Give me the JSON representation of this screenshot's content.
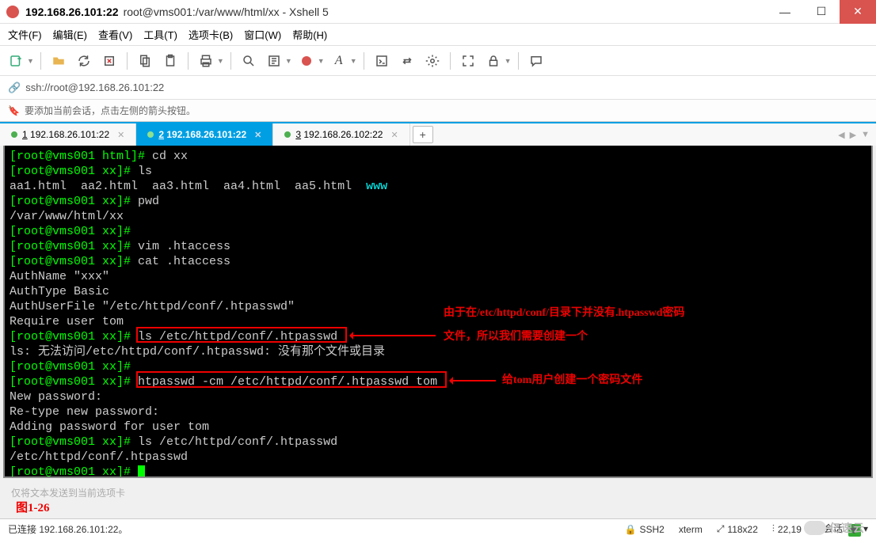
{
  "title": {
    "host": "192.168.26.101:22",
    "path": "root@vms001:/var/www/html/xx - Xshell 5"
  },
  "menu": [
    "文件(F)",
    "编辑(E)",
    "查看(V)",
    "工具(T)",
    "选项卡(B)",
    "窗口(W)",
    "帮助(H)"
  ],
  "address": "ssh://root@192.168.26.101:22",
  "infobar": "要添加当前会话，点击左侧的箭头按钮。",
  "tabs": [
    {
      "label": "1 192.168.26.101:22",
      "active": false
    },
    {
      "label": "2 192.168.26.101:22",
      "active": true
    },
    {
      "label": "3 192.168.26.102:22",
      "active": false
    }
  ],
  "terminal_lines": [
    {
      "seg": [
        {
          "c": "tp",
          "t": "[root@vms001 html]# "
        },
        {
          "c": "tc",
          "t": "cd xx"
        }
      ]
    },
    {
      "seg": [
        {
          "c": "tp",
          "t": "[root@vms001 xx]# "
        },
        {
          "c": "tc",
          "t": "ls"
        }
      ]
    },
    {
      "seg": [
        {
          "c": "tc",
          "t": "aa1.html  aa2.html  aa3.html  aa4.html  aa5.html  "
        },
        {
          "c": "tw",
          "t": "www"
        }
      ]
    },
    {
      "seg": [
        {
          "c": "tp",
          "t": "[root@vms001 xx]# "
        },
        {
          "c": "tc",
          "t": "pwd"
        }
      ]
    },
    {
      "seg": [
        {
          "c": "tc",
          "t": "/var/www/html/xx"
        }
      ]
    },
    {
      "seg": [
        {
          "c": "tp",
          "t": "[root@vms001 xx]# "
        }
      ]
    },
    {
      "seg": [
        {
          "c": "tp",
          "t": "[root@vms001 xx]# "
        },
        {
          "c": "tc",
          "t": "vim .htaccess"
        }
      ]
    },
    {
      "seg": [
        {
          "c": "tp",
          "t": "[root@vms001 xx]# "
        },
        {
          "c": "tc",
          "t": "cat .htaccess"
        }
      ]
    },
    {
      "seg": [
        {
          "c": "tc",
          "t": "AuthName \"xxx\""
        }
      ]
    },
    {
      "seg": [
        {
          "c": "tc",
          "t": "AuthType Basic"
        }
      ]
    },
    {
      "seg": [
        {
          "c": "tc",
          "t": "AuthUserFile \"/etc/httpd/conf/.htpasswd\""
        }
      ]
    },
    {
      "seg": [
        {
          "c": "tc",
          "t": "Require user tom"
        }
      ]
    },
    {
      "seg": [
        {
          "c": "tp",
          "t": "[root@vms001 xx]# "
        },
        {
          "c": "tc",
          "t": "ls /etc/httpd/conf/.htpasswd"
        }
      ]
    },
    {
      "seg": [
        {
          "c": "tc",
          "t": "ls: 无法访问/etc/httpd/conf/.htpasswd: 没有那个文件或目录"
        }
      ]
    },
    {
      "seg": [
        {
          "c": "tp",
          "t": "[root@vms001 xx]# "
        }
      ]
    },
    {
      "seg": [
        {
          "c": "tp",
          "t": "[root@vms001 xx]# "
        },
        {
          "c": "tc",
          "t": "htpasswd -cm /etc/httpd/conf/.htpasswd tom"
        }
      ]
    },
    {
      "seg": [
        {
          "c": "tc",
          "t": "New password: "
        }
      ]
    },
    {
      "seg": [
        {
          "c": "tc",
          "t": "Re-type new password: "
        }
      ]
    },
    {
      "seg": [
        {
          "c": "tc",
          "t": "Adding password for user tom"
        }
      ]
    },
    {
      "seg": [
        {
          "c": "tp",
          "t": "[root@vms001 xx]# "
        },
        {
          "c": "tc",
          "t": "ls /etc/httpd/conf/.htpasswd"
        }
      ]
    },
    {
      "seg": [
        {
          "c": "tc",
          "t": "/etc/httpd/conf/.htpasswd"
        }
      ]
    },
    {
      "seg": [
        {
          "c": "tp",
          "t": "[root@vms001 xx]# "
        },
        {
          "c": "cursor",
          "t": ""
        }
      ]
    }
  ],
  "annotations": {
    "a1_line1": "由于在/etc/httpd/conf/目录下并没有.htpasswd密码",
    "a1_line2": "文件，所以我们需要创建一个",
    "a2": "给tom用户创建一个密码文件"
  },
  "input_placeholder": "仅将文本发送到当前选项卡",
  "figlabel": "图1-26",
  "status": {
    "left": "已连接 192.168.26.101:22。",
    "ssh": "SSH2",
    "term": "xterm",
    "size": "118x22",
    "pos": "22,19",
    "sess": "3 会话"
  },
  "watermark": "亿速云"
}
